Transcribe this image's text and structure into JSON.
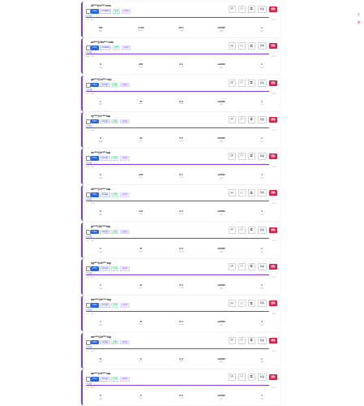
{
  "side": {
    "top_icon": "⇱",
    "bottom_icon": "⚙"
  },
  "labels": {
    "detail_button": "查看",
    "delete_button": "删除",
    "stats": [
      "额度",
      "Tokens",
      "Credits",
      "剩余",
      "总数"
    ]
  },
  "accounts": [
    {
      "email": "dl****@e****.com",
      "tags": [
        "PRO",
        "Pro/Bard",
        "正常",
        "已同步"
      ],
      "state": "已完成",
      "sub": "DL2 · 4096",
      "progress": 100,
      "stats": [
        "100",
        "4 100",
        "29.4",
        "≤20/90",
        "1"
      ],
      "extra": "可用"
    },
    {
      "email": "ad****@fra****.com",
      "tags": [
        "PRO",
        "Pro/Bard",
        "正常",
        "已同步"
      ],
      "state": "已完成",
      "sub": "DL2 · 4096",
      "progress": 100,
      "stats": [
        "6",
        "202",
        "0.1",
        "≤20/90",
        "1"
      ],
      "extra": "可用"
    },
    {
      "email": "ph****@vi****.top",
      "tags": [
        "PRO",
        "Google",
        "正常",
        "已同步"
      ],
      "state": "已完成",
      "sub": "DL2 · 4096",
      "progress": 100,
      "stats": [
        "1",
        "47",
        "0.0",
        "≤20/90",
        "1"
      ],
      "extra": "可用"
    },
    {
      "email": "vy****@v****.top",
      "tags": [
        "PRO",
        "Google",
        "正常",
        "已同步"
      ],
      "state": "已完成",
      "sub": "DL2 · 4096",
      "progress": 100,
      "stats": [
        "3",
        "94",
        "0.0",
        "≤20/90",
        "1"
      ],
      "extra": "可用"
    },
    {
      "email": "ss****@a****.top",
      "tags": [
        "PRO",
        "Google",
        "正常",
        "已同步"
      ],
      "state": "已完成",
      "sub": "DL2 · 4096",
      "progress": 100,
      "stats": [
        "2",
        "202",
        "0.1",
        "≤20/90",
        "1"
      ],
      "extra": "可用"
    },
    {
      "email": "ab****@v****.top",
      "tags": [
        "PRO",
        "Google",
        "正常",
        "已同步"
      ],
      "state": "已完成",
      "sub": "DL2 · 4096",
      "progress": 100,
      "stats": [
        "3",
        "141",
        "0.0",
        "≤20/90",
        "1"
      ],
      "extra": "可用"
    },
    {
      "email": "jw****@d****.top",
      "tags": [
        "PRO",
        "Google",
        "正常",
        "已同步"
      ],
      "state": "已完成",
      "sub": "DL2 · 4096",
      "progress": 100,
      "stats": [
        "1",
        "47",
        "0.0",
        "≤20/90",
        "1"
      ],
      "extra": "可用"
    },
    {
      "email": "ng****@d****.top",
      "tags": [
        "PRO",
        "Google",
        "正常",
        "已同步"
      ],
      "state": "已完成",
      "sub": "DL2 · 4096",
      "progress": 100,
      "stats": [
        "1",
        "47",
        "0.0",
        "≤20/90",
        "1"
      ],
      "extra": "可用"
    },
    {
      "email": "dw****@a****.top",
      "tags": [
        "PRO",
        "Google",
        "正常",
        "已同步"
      ],
      "state": "已完成",
      "sub": "DL2 · 4096",
      "progress": 100,
      "stats": [
        "1",
        "47",
        "0.0",
        "≤20/90",
        "1"
      ],
      "extra": "可用"
    },
    {
      "email": "wu****@d****.top",
      "tags": [
        "PRO",
        "Google",
        "正常",
        "已同步"
      ],
      "state": "已完成",
      "sub": "DL2 · 4096",
      "progress": 100,
      "stats": [
        "0",
        "0",
        "0.0",
        "≤20/90",
        "1"
      ],
      "extra": "可用"
    },
    {
      "email": "aa****@d****.top",
      "tags": [
        "PRO",
        "Google",
        "正常",
        "已同步"
      ],
      "state": "已完成",
      "sub": "DL2 · 4096",
      "progress": 100,
      "stats": [
        "0",
        "0",
        "0.0",
        "≤20/90",
        "1"
      ],
      "extra": "可用"
    }
  ]
}
